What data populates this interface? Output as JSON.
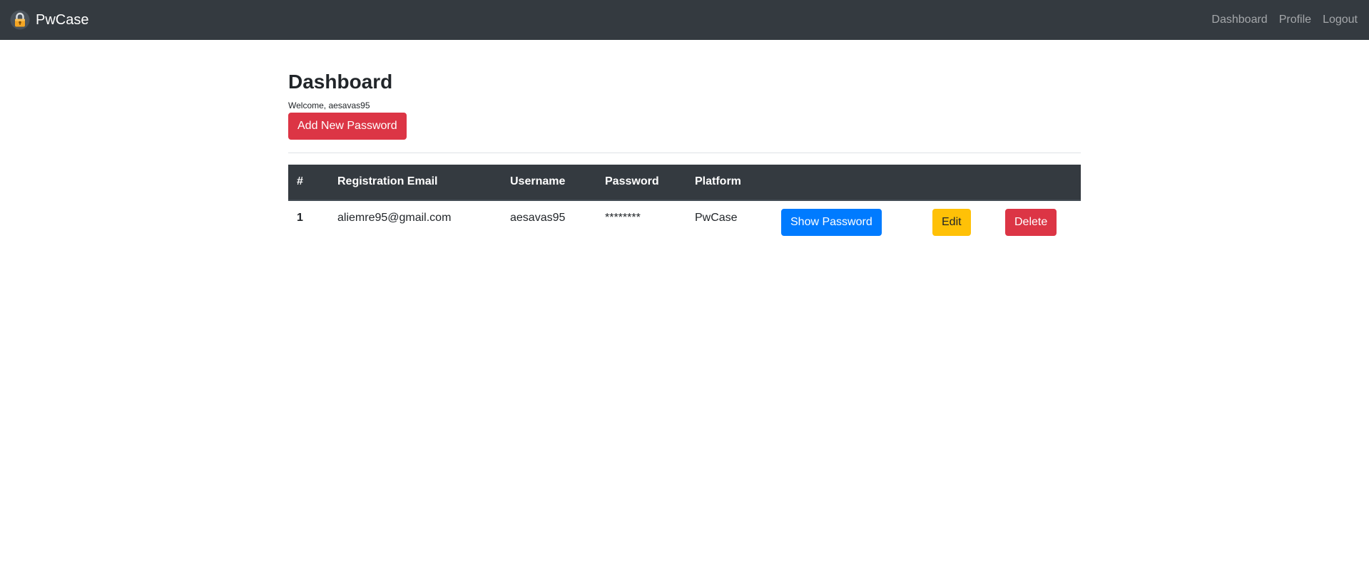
{
  "navbar": {
    "brand": "PwCase",
    "links": [
      "Dashboard",
      "Profile",
      "Logout"
    ]
  },
  "main": {
    "title": "Dashboard",
    "welcome": "Welcome, aesavas95",
    "add_button": "Add New Password"
  },
  "table": {
    "headers": [
      "#",
      "Registration Email",
      "Username",
      "Password",
      "Platform"
    ],
    "rows": [
      {
        "num": "1",
        "email": "aliemre95@gmail.com",
        "username": "aesavas95",
        "password": "********",
        "platform": "PwCase",
        "show_label": "Show Password",
        "edit_label": "Edit",
        "delete_label": "Delete"
      }
    ]
  },
  "colors": {
    "navbar": "#343a40",
    "danger": "#dc3545",
    "primary": "#007bff",
    "warning": "#ffc107"
  },
  "icons": {
    "brand": "padlock-icon"
  }
}
